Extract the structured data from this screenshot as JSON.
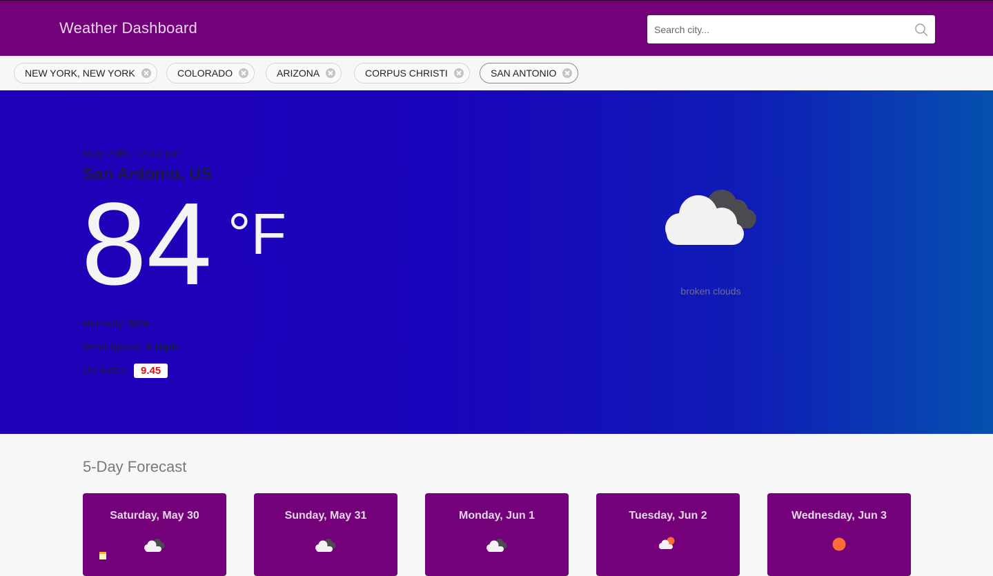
{
  "header": {
    "title": "Weather Dashboard",
    "search_placeholder": "Search city...",
    "background_color": "#74007a"
  },
  "chips": [
    {
      "label": "NEW YORK, NEW YORK"
    },
    {
      "label": "COLORADO"
    },
    {
      "label": "ARIZONA"
    },
    {
      "label": "CORPUS CHRISTI"
    },
    {
      "label": "SAN ANTONIO",
      "active": true
    }
  ],
  "current": {
    "date": "May 29th, 12:40 pm",
    "city": "San Antonio, US",
    "temperature": "84",
    "unit": "°F",
    "humidity_label": "Humidity:",
    "humidity_value": "51%",
    "wind_label": "Wind Speed:",
    "wind_value": "4.1kph",
    "uv_label": "UV Index:",
    "uv_value": "9.45",
    "description": "broken clouds",
    "icon": "broken-clouds-icon"
  },
  "forecast": {
    "title": "5-Day Forecast",
    "days": [
      {
        "day": "Saturday, May 30",
        "icon": "broken-clouds-icon"
      },
      {
        "day": "Sunday, May 31",
        "icon": "broken-clouds-icon"
      },
      {
        "day": "Monday, Jun 1",
        "icon": "broken-clouds-icon"
      },
      {
        "day": "Tuesday, Jun 2",
        "icon": "few-clouds-icon"
      },
      {
        "day": "Wednesday, Jun 3",
        "icon": "clear-sky-icon"
      }
    ]
  },
  "colors": {
    "brand": "#74007a",
    "uv_high": "#e01010",
    "sun": "#ff6b35"
  }
}
